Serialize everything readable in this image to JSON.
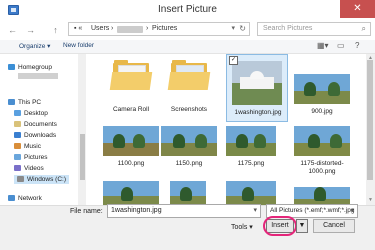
{
  "window": {
    "title": "Insert Picture",
    "close_glyph": "✕"
  },
  "nav": {
    "back_glyph": "←",
    "forward_glyph": "→",
    "up_glyph": "↑",
    "path": [
      "Users",
      "Pictures"
    ],
    "search_placeholder": "Search Pictures"
  },
  "toolbar": {
    "organize": "Organize ▾",
    "new_folder": "New folder"
  },
  "sidebar": {
    "items": [
      {
        "label": "Homegroup"
      },
      {
        "label": "This PC"
      },
      {
        "label": "Desktop"
      },
      {
        "label": "Documents"
      },
      {
        "label": "Downloads"
      },
      {
        "label": "Music"
      },
      {
        "label": "Pictures"
      },
      {
        "label": "Videos"
      },
      {
        "label": "Windows (C:)"
      },
      {
        "label": "Network"
      }
    ]
  },
  "files": [
    {
      "name": "Camera Roll",
      "kind": "folder"
    },
    {
      "name": "Screenshots",
      "kind": "folder"
    },
    {
      "name": "1washington.jpg",
      "kind": "photo",
      "selected": true
    },
    {
      "name": "900.jpg",
      "kind": "photo"
    },
    {
      "name": "1100.png",
      "kind": "photo"
    },
    {
      "name": "1150.png",
      "kind": "photo"
    },
    {
      "name": "1175.png",
      "kind": "photo"
    },
    {
      "name": "1175-distorted-1000.png",
      "kind": "photo"
    },
    {
      "name": "",
      "kind": "photo"
    },
    {
      "name": "",
      "kind": "photo"
    },
    {
      "name": "",
      "kind": "photo"
    },
    {
      "name": "",
      "kind": "photo"
    }
  ],
  "file_name": {
    "label": "File name:",
    "value": "1washington.jpg"
  },
  "file_type": {
    "value": "All Pictures (*.emf;*.wmf;*.jpg"
  },
  "buttons": {
    "tools": "Tools",
    "insert": "Insert",
    "cancel": "Cancel"
  },
  "colors": {
    "accent_ring": "#e4267a",
    "close": "#c7504f",
    "selection": "#cce4f7"
  }
}
